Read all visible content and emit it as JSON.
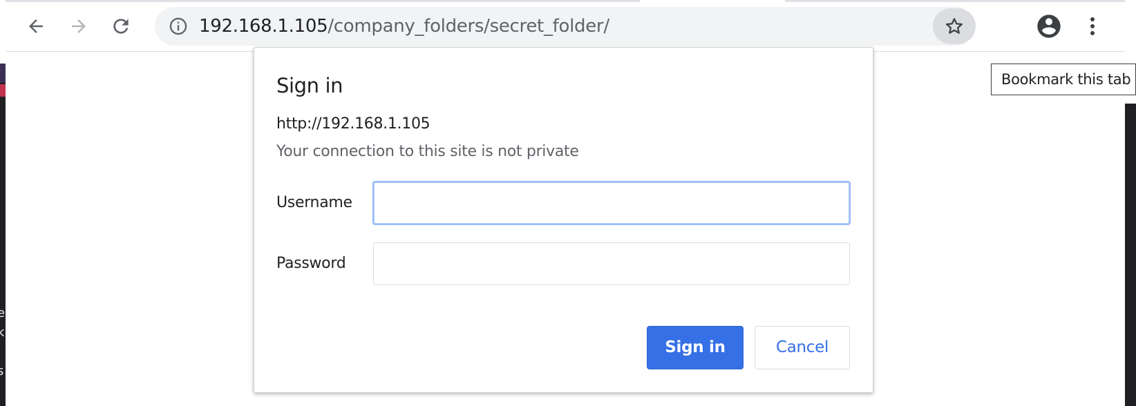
{
  "browser": {
    "address_bar": {
      "host": "192.168.1.105",
      "path": "/company_folders/secret_folder/"
    },
    "icons": {
      "back": "arrow-left-icon",
      "forward": "arrow-right-icon",
      "reload": "reload-icon",
      "site_info": "info-icon",
      "bookmark": "star-icon",
      "profile": "account-circle-icon",
      "menu": "more-vertical-icon"
    },
    "tooltip": "Bookmark this tab"
  },
  "dialog": {
    "title": "Sign in",
    "origin": "http://192.168.1.105",
    "warning": "Your connection to this site is not private",
    "username_label": "Username",
    "username_value": "",
    "password_label": "Password",
    "password_value": "",
    "signin_label": "Sign in",
    "cancel_label": "Cancel"
  },
  "desktop": {
    "left_edge_glyphs": "e k : s :"
  },
  "colors": {
    "primary_button": "#3670e6",
    "focus_ring": "#a8c7fa",
    "omnibox_bg": "#f1f3f4"
  }
}
